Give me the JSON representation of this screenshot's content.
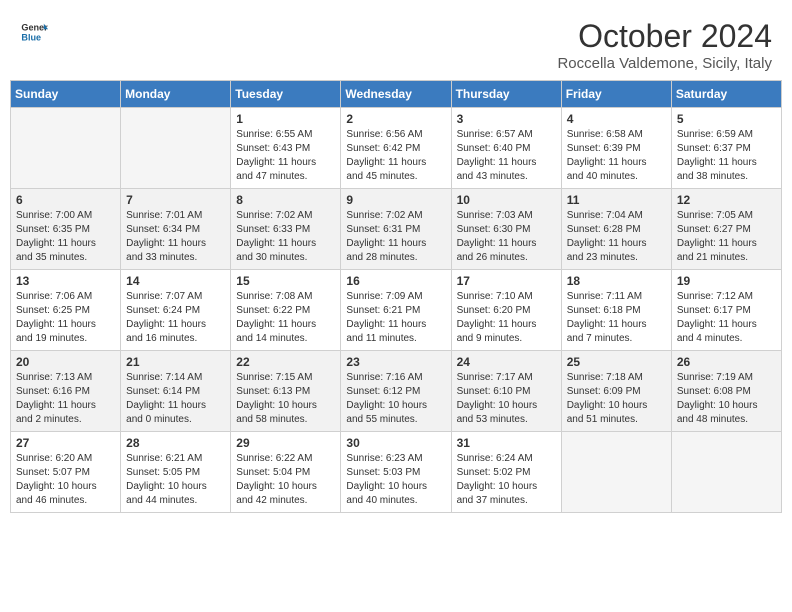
{
  "header": {
    "logo_line1": "General",
    "logo_line2": "Blue",
    "month": "October 2024",
    "location": "Roccella Valdemone, Sicily, Italy"
  },
  "columns": [
    "Sunday",
    "Monday",
    "Tuesday",
    "Wednesday",
    "Thursday",
    "Friday",
    "Saturday"
  ],
  "weeks": [
    [
      {
        "day": "",
        "info": ""
      },
      {
        "day": "",
        "info": ""
      },
      {
        "day": "1",
        "info": "Sunrise: 6:55 AM\nSunset: 6:43 PM\nDaylight: 11 hours and 47 minutes."
      },
      {
        "day": "2",
        "info": "Sunrise: 6:56 AM\nSunset: 6:42 PM\nDaylight: 11 hours and 45 minutes."
      },
      {
        "day": "3",
        "info": "Sunrise: 6:57 AM\nSunset: 6:40 PM\nDaylight: 11 hours and 43 minutes."
      },
      {
        "day": "4",
        "info": "Sunrise: 6:58 AM\nSunset: 6:39 PM\nDaylight: 11 hours and 40 minutes."
      },
      {
        "day": "5",
        "info": "Sunrise: 6:59 AM\nSunset: 6:37 PM\nDaylight: 11 hours and 38 minutes."
      }
    ],
    [
      {
        "day": "6",
        "info": "Sunrise: 7:00 AM\nSunset: 6:35 PM\nDaylight: 11 hours and 35 minutes."
      },
      {
        "day": "7",
        "info": "Sunrise: 7:01 AM\nSunset: 6:34 PM\nDaylight: 11 hours and 33 minutes."
      },
      {
        "day": "8",
        "info": "Sunrise: 7:02 AM\nSunset: 6:33 PM\nDaylight: 11 hours and 30 minutes."
      },
      {
        "day": "9",
        "info": "Sunrise: 7:02 AM\nSunset: 6:31 PM\nDaylight: 11 hours and 28 minutes."
      },
      {
        "day": "10",
        "info": "Sunrise: 7:03 AM\nSunset: 6:30 PM\nDaylight: 11 hours and 26 minutes."
      },
      {
        "day": "11",
        "info": "Sunrise: 7:04 AM\nSunset: 6:28 PM\nDaylight: 11 hours and 23 minutes."
      },
      {
        "day": "12",
        "info": "Sunrise: 7:05 AM\nSunset: 6:27 PM\nDaylight: 11 hours and 21 minutes."
      }
    ],
    [
      {
        "day": "13",
        "info": "Sunrise: 7:06 AM\nSunset: 6:25 PM\nDaylight: 11 hours and 19 minutes."
      },
      {
        "day": "14",
        "info": "Sunrise: 7:07 AM\nSunset: 6:24 PM\nDaylight: 11 hours and 16 minutes."
      },
      {
        "day": "15",
        "info": "Sunrise: 7:08 AM\nSunset: 6:22 PM\nDaylight: 11 hours and 14 minutes."
      },
      {
        "day": "16",
        "info": "Sunrise: 7:09 AM\nSunset: 6:21 PM\nDaylight: 11 hours and 11 minutes."
      },
      {
        "day": "17",
        "info": "Sunrise: 7:10 AM\nSunset: 6:20 PM\nDaylight: 11 hours and 9 minutes."
      },
      {
        "day": "18",
        "info": "Sunrise: 7:11 AM\nSunset: 6:18 PM\nDaylight: 11 hours and 7 minutes."
      },
      {
        "day": "19",
        "info": "Sunrise: 7:12 AM\nSunset: 6:17 PM\nDaylight: 11 hours and 4 minutes."
      }
    ],
    [
      {
        "day": "20",
        "info": "Sunrise: 7:13 AM\nSunset: 6:16 PM\nDaylight: 11 hours and 2 minutes."
      },
      {
        "day": "21",
        "info": "Sunrise: 7:14 AM\nSunset: 6:14 PM\nDaylight: 11 hours and 0 minutes."
      },
      {
        "day": "22",
        "info": "Sunrise: 7:15 AM\nSunset: 6:13 PM\nDaylight: 10 hours and 58 minutes."
      },
      {
        "day": "23",
        "info": "Sunrise: 7:16 AM\nSunset: 6:12 PM\nDaylight: 10 hours and 55 minutes."
      },
      {
        "day": "24",
        "info": "Sunrise: 7:17 AM\nSunset: 6:10 PM\nDaylight: 10 hours and 53 minutes."
      },
      {
        "day": "25",
        "info": "Sunrise: 7:18 AM\nSunset: 6:09 PM\nDaylight: 10 hours and 51 minutes."
      },
      {
        "day": "26",
        "info": "Sunrise: 7:19 AM\nSunset: 6:08 PM\nDaylight: 10 hours and 48 minutes."
      }
    ],
    [
      {
        "day": "27",
        "info": "Sunrise: 6:20 AM\nSunset: 5:07 PM\nDaylight: 10 hours and 46 minutes."
      },
      {
        "day": "28",
        "info": "Sunrise: 6:21 AM\nSunset: 5:05 PM\nDaylight: 10 hours and 44 minutes."
      },
      {
        "day": "29",
        "info": "Sunrise: 6:22 AM\nSunset: 5:04 PM\nDaylight: 10 hours and 42 minutes."
      },
      {
        "day": "30",
        "info": "Sunrise: 6:23 AM\nSunset: 5:03 PM\nDaylight: 10 hours and 40 minutes."
      },
      {
        "day": "31",
        "info": "Sunrise: 6:24 AM\nSunset: 5:02 PM\nDaylight: 10 hours and 37 minutes."
      },
      {
        "day": "",
        "info": ""
      },
      {
        "day": "",
        "info": ""
      }
    ]
  ]
}
